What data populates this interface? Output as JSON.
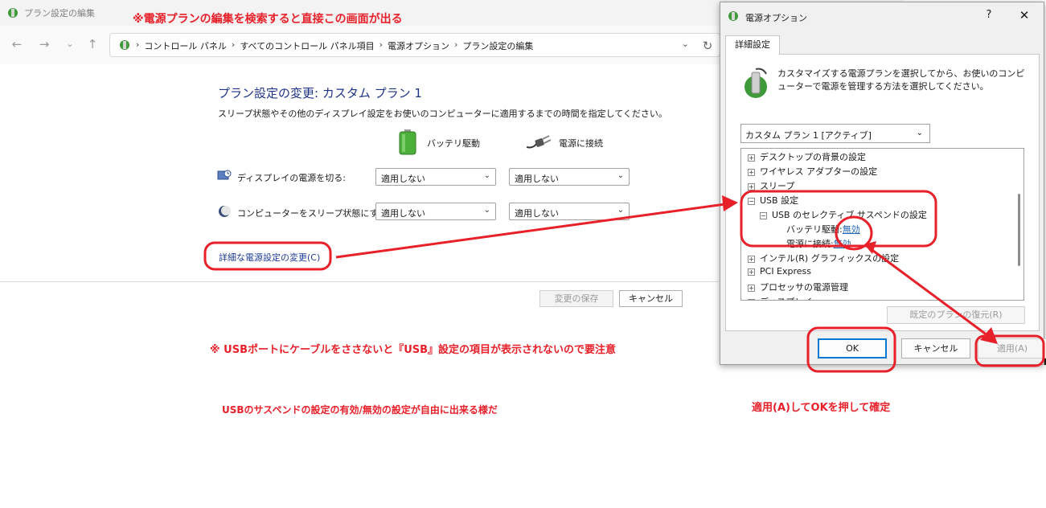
{
  "main": {
    "window_title": "プラン設定の編集",
    "breadcrumb": [
      "コントロール パネル",
      "すべてのコントロール パネル項目",
      "電源オプション",
      "プラン設定の編集"
    ],
    "plan_title": "プラン設定の変更: カスタム プラン 1",
    "plan_description": "スリープ状態やその他のディスプレイ設定をお使いのコンピューターに適用するまでの時間を指定してください。",
    "columns": {
      "battery": "バッテリ駆動",
      "plugged": "電源に接続"
    },
    "rows": [
      {
        "label": "ディスプレイの電源を切る:",
        "battery": "適用しない",
        "plugged": "適用しない"
      },
      {
        "label": "コンピューターをスリープ状態にする:",
        "battery": "適用しない",
        "plugged": "適用しない"
      }
    ],
    "advanced_link": "詳細な電源設定の変更(C)",
    "save_button": "変更の保存",
    "cancel_button": "キャンセル"
  },
  "dialog": {
    "title": "電源オプション",
    "help": "?",
    "close": "✕",
    "tab": "詳細設定",
    "description": "カスタマイズする電源プランを選択してから、お使いのコンピューターで電源を管理する方法を選択してください。",
    "plan_select": "カスタム プラン 1 [アクティブ]",
    "tree": [
      {
        "label": "デスクトップの背景の設定",
        "exp": "+",
        "level": 0
      },
      {
        "label": "ワイヤレス アダプターの設定",
        "exp": "+",
        "level": 0
      },
      {
        "label": "スリープ",
        "exp": "+",
        "level": 0
      },
      {
        "label": "USB 設定",
        "exp": "−",
        "level": 0
      },
      {
        "label": "USB のセレクティブ サスペンドの設定",
        "exp": "−",
        "level": 1
      },
      {
        "label": "バッテリ駆動:",
        "value": "無効",
        "level": 2
      },
      {
        "label": "電源に接続:",
        "value": "無効",
        "level": 2
      },
      {
        "label": "インテル(R) グラフィックスの設定",
        "exp": "+",
        "level": 0
      },
      {
        "label": "PCI Express",
        "exp": "+",
        "level": 0
      },
      {
        "label": "プロセッサの電源管理",
        "exp": "+",
        "level": 0
      },
      {
        "label": "ディスプレイ",
        "exp": "+",
        "level": 0
      }
    ],
    "restore_button": "既定のプランの復元(R)",
    "ok_button": "OK",
    "cancel_button": "キャンセル",
    "apply_button": "適用(A)"
  },
  "annotations": {
    "top": "※電源プランの編集を検索すると直接この画面が出る",
    "note_usb": "※ USBポートにケーブルをささないと『USB』設定の項目が表示されないので要注意",
    "note_suspend": "USBのサスペンドの設定の有効/無効の設定が自由に出来る様だ",
    "note_apply": "適用(A)してOKを押して確定"
  },
  "colors": {
    "annotation": "#e8202a",
    "link": "#1e3c96",
    "title": "#1e3287"
  }
}
